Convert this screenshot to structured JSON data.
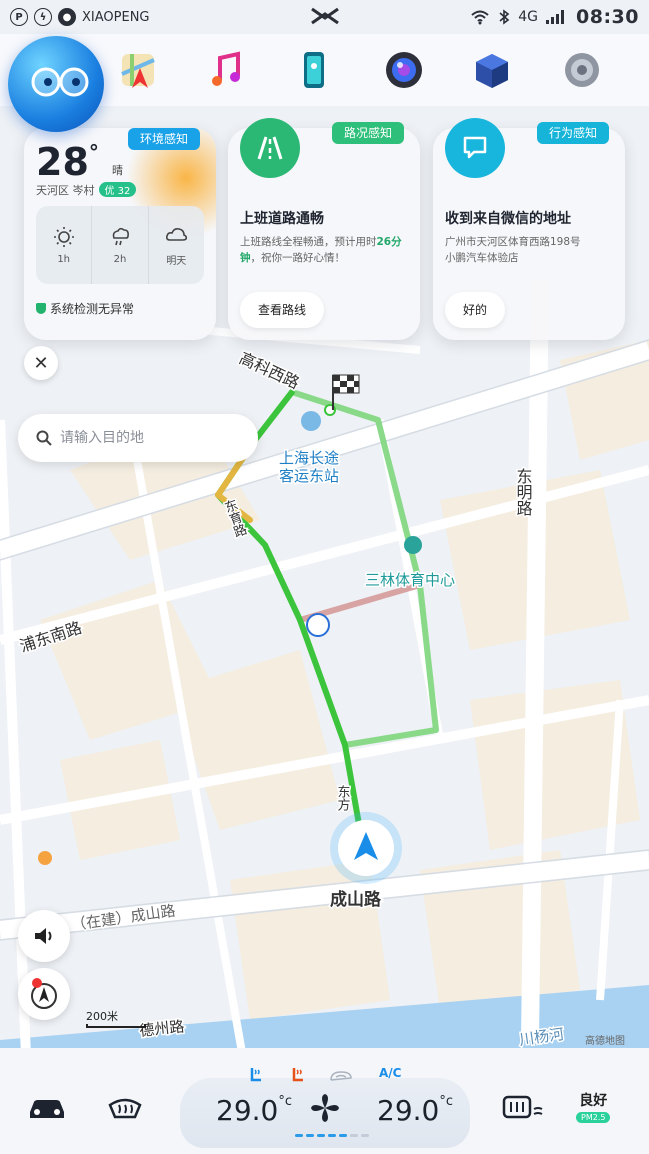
{
  "status_bar": {
    "brand": "XIAOPENG",
    "network": "4G",
    "time": "08:30"
  },
  "dock": {
    "items": [
      "maps-icon",
      "music-icon",
      "phone-icon",
      "camera-icon",
      "apps-cube-icon",
      "settings-icon"
    ]
  },
  "weather_card": {
    "tag": "环境感知",
    "temperature": "28",
    "degree": "°",
    "condition": "晴",
    "location": "天河区 岑村",
    "aqi": "优 32",
    "forecast": [
      {
        "label": "1h"
      },
      {
        "label": "2h"
      },
      {
        "label": "明天"
      }
    ],
    "system_status": "系统检测无异常"
  },
  "traffic_card": {
    "tag": "路况感知",
    "title": "上班道路通畅",
    "body_prefix": "上班路线全程畅通，预计用时",
    "eta": "26分钟",
    "body_suffix": "，祝你一路好心情！",
    "button": "查看路线"
  },
  "behavior_card": {
    "tag": "行为感知",
    "title": "收到来自微信的地址",
    "body_line1": "广州市天河区体育西路198号",
    "body_line2": "小鹏汽车体验店",
    "button": "好的"
  },
  "search": {
    "placeholder": "请输入目的地"
  },
  "map": {
    "labels": {
      "gaoke": "高科西路",
      "dongming": "东明路",
      "pudong_south": "浦东南路",
      "chengshan": "成山路",
      "chengshan_construction": "（在建）成山路",
      "dezhou": "德州路",
      "chuanyang": "川杨河",
      "changtu_line1": "上海长途",
      "changtu_line2": "客运东站",
      "sanlin": "三林体育中心",
      "vertical_road": "东育路",
      "bottom_road": "东方"
    },
    "scale": "200米",
    "watermark": "高德地图"
  },
  "climate": {
    "left_temp": "29.0",
    "right_temp": "29.0",
    "unit": "°c",
    "ac": "A/C",
    "fan_level": 5,
    "fan_max": 7,
    "air_quality": "良好",
    "pm": "PM2.5"
  }
}
